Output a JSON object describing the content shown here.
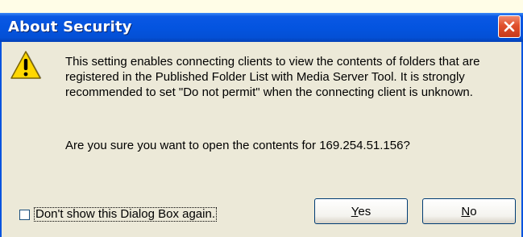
{
  "dialog": {
    "title": "About Security",
    "message": "This setting enables connecting clients to view the contents of folders that are registered in the Published Folder List with Media Server Tool. It is strongly recommended to set \"Do not permit\" when the connecting client is unknown.",
    "question": "Are you sure you want to open the contents for 169.254.51.156?",
    "checkbox_label": "Don't show this Dialog Box again.",
    "checkbox_checked": false,
    "yes_label": "Yes",
    "no_label": "No"
  },
  "icons": {
    "warning": "warning-icon",
    "close": "close-icon"
  },
  "colors": {
    "titlebar": "#0454e0",
    "close_button": "#e0502c",
    "dialog_bg": "#ece9d8"
  }
}
